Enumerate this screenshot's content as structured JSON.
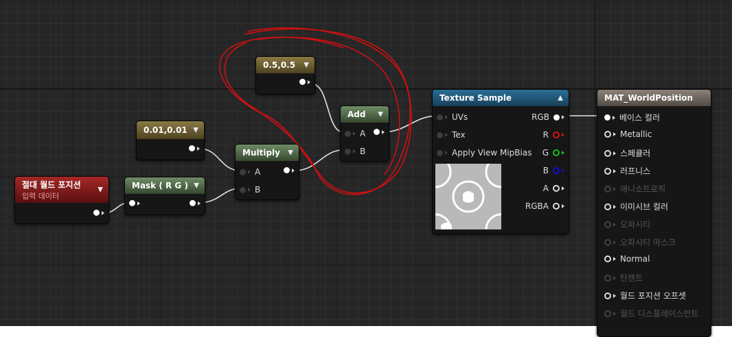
{
  "nodes": {
    "const_05": {
      "title": "0.5,0.5"
    },
    "const_001": {
      "title": "0.01,0.01"
    },
    "abs_world": {
      "title": "절대 월드 포지션",
      "subtitle": "입력 데이터"
    },
    "mask": {
      "title": "Mask ( R G )"
    },
    "multiply": {
      "title": "Multiply",
      "pin_a": "A",
      "pin_b": "B"
    },
    "add": {
      "title": "Add",
      "pin_a": "A",
      "pin_b": "B"
    },
    "texture": {
      "title": "Texture Sample",
      "inputs": [
        "UVs",
        "Tex",
        "Apply View MipBias"
      ],
      "outputs": [
        "RGB",
        "R",
        "G",
        "B",
        "A",
        "RGBA"
      ]
    },
    "material": {
      "title": "MAT_WorldPosition",
      "pins": [
        "베이스 컬러",
        "Metallic",
        "스페큘러",
        "러프니스",
        "애니소트로픽",
        "이미시브 컬러",
        "오파시티",
        "오파시티 마스크",
        "Normal",
        "탄젠트",
        "월드 포지션 오프셋",
        "월드 디스플레이스먼트"
      ]
    }
  },
  "colors": {
    "pin_r": "#e01010",
    "pin_g": "#10c010",
    "pin_b": "#1010d0",
    "annotation": "#d01010",
    "wire": "#e6e6e6"
  }
}
